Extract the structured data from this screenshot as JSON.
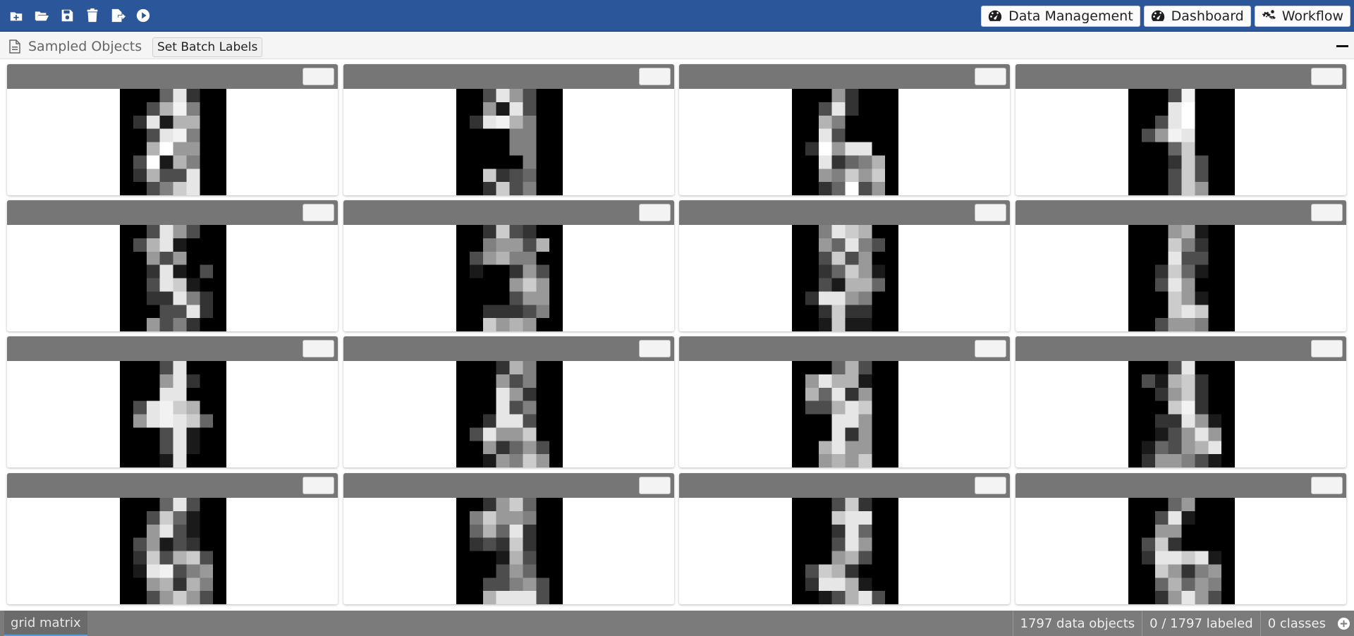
{
  "toolbar": {
    "icons": [
      "new-icon",
      "open-folder-icon",
      "save-icon",
      "delete-icon",
      "export-icon",
      "run-icon"
    ],
    "nav": {
      "data_management": "Data Management",
      "dashboard": "Dashboard",
      "workflow": "Workflow"
    }
  },
  "panel": {
    "title": "Sampled Objects",
    "batch_button": "Set Batch Labels"
  },
  "grid": {
    "rows": 4,
    "columns": 4,
    "cards": [
      {
        "label": "",
        "pixels": [
          0,
          0,
          0,
          0.4,
          0.9,
          0.2,
          0,
          0,
          0,
          0,
          0.3,
          0.7,
          0.95,
          0.5,
          0,
          0,
          0,
          0.2,
          0.9,
          0.1,
          0.7,
          0.7,
          0,
          0,
          0,
          0,
          0.3,
          0.9,
          0.95,
          0.5,
          0,
          0,
          0,
          0,
          0.7,
          1,
          0.6,
          0.6,
          0,
          0,
          0,
          0.3,
          1,
          0.1,
          0.7,
          0.5,
          0,
          0,
          0,
          0.2,
          0.7,
          0.3,
          0.3,
          0.9,
          0,
          0,
          0,
          0,
          0.3,
          0.5,
          0.8,
          0.9,
          0,
          0
        ]
      },
      {
        "label": "",
        "pixels": [
          0,
          0,
          0.3,
          0.9,
          0.6,
          0.3,
          0,
          0,
          0,
          0,
          0.6,
          0.1,
          0.9,
          0.3,
          0,
          0,
          0,
          0.2,
          0.9,
          0.95,
          0.7,
          0.5,
          0,
          0,
          0,
          0,
          0,
          0,
          0.5,
          0.5,
          0,
          0,
          0,
          0,
          0,
          0,
          0.5,
          0.5,
          0,
          0,
          0,
          0,
          0,
          0,
          0,
          0.5,
          0,
          0,
          0,
          0,
          0.8,
          0.2,
          0.3,
          0.4,
          0,
          0,
          0,
          0,
          0.2,
          0.8,
          0.3,
          0.5,
          0,
          0
        ]
      },
      {
        "label": "",
        "pixels": [
          0,
          0,
          0,
          0.6,
          0.2,
          0,
          0,
          0,
          0,
          0,
          0.3,
          0.9,
          0.2,
          0,
          0,
          0,
          0,
          0,
          0.7,
          0.5,
          0,
          0,
          0,
          0,
          0,
          0,
          0.9,
          0.3,
          0,
          0,
          0,
          0,
          0,
          0.2,
          1,
          0.6,
          0.9,
          0.9,
          0,
          0,
          0,
          0,
          0.9,
          0.2,
          0.4,
          0.5,
          0.7,
          0,
          0,
          0,
          0.6,
          0.5,
          0.8,
          0.6,
          0.8,
          0,
          0,
          0,
          0.2,
          0.4,
          1,
          0.3,
          0.6,
          0
        ]
      },
      {
        "label": "",
        "pixels": [
          0,
          0,
          0,
          0.3,
          0.95,
          0,
          0,
          0,
          0,
          0,
          0,
          0.9,
          1,
          0,
          0,
          0,
          0,
          0,
          0.3,
          0.9,
          1,
          0,
          0,
          0,
          0,
          0.3,
          0.6,
          0.95,
          0.9,
          0,
          0,
          0,
          0,
          0,
          0,
          0.4,
          0.8,
          0,
          0,
          0,
          0,
          0,
          0,
          0.2,
          0.8,
          0.3,
          0,
          0,
          0,
          0,
          0,
          0.3,
          0.8,
          0.3,
          0,
          0,
          0,
          0,
          0,
          0.3,
          0.8,
          0.6,
          0,
          0
        ]
      },
      {
        "label": "",
        "pixels": [
          0,
          0,
          0.3,
          0.9,
          0.6,
          0.3,
          0,
          0,
          0,
          0.3,
          0.7,
          0.9,
          0.1,
          0,
          0,
          0,
          0,
          0,
          0.6,
          0.3,
          0.6,
          0,
          0,
          0,
          0,
          0,
          0.2,
          0.9,
          0.1,
          0,
          0.3,
          0,
          0,
          0,
          0.3,
          0.9,
          0.8,
          0.1,
          0,
          0,
          0,
          0,
          0.2,
          0.2,
          0.9,
          0.5,
          0.2,
          0,
          0,
          0,
          0,
          0.3,
          0.3,
          0.9,
          0.2,
          0,
          0,
          0,
          0.6,
          0.3,
          0.5,
          0.2,
          0,
          0
        ]
      },
      {
        "label": "",
        "pixels": [
          0,
          0,
          0.2,
          0.8,
          0.3,
          0.2,
          0,
          0,
          0,
          0,
          0.5,
          0.6,
          0.6,
          0.3,
          0.7,
          0,
          0,
          0.3,
          0.6,
          0.7,
          0.5,
          0.5,
          0,
          0,
          0,
          0.1,
          0,
          0,
          0.2,
          0.6,
          0.3,
          0,
          0,
          0,
          0,
          0,
          0.6,
          0.8,
          0.6,
          0,
          0,
          0,
          0,
          0,
          0.3,
          0.6,
          0.6,
          0,
          0,
          0,
          0.2,
          0.2,
          0.2,
          0.3,
          0.5,
          0,
          0,
          0,
          0.8,
          0.6,
          0.7,
          0.6,
          0,
          0
        ]
      },
      {
        "label": "",
        "pixels": [
          0,
          0,
          0.5,
          0.9,
          0.8,
          0.7,
          0,
          0,
          0,
          0,
          0.6,
          0.4,
          0.9,
          0.5,
          0.3,
          0,
          0,
          0,
          0.3,
          0.8,
          0.3,
          0.6,
          0,
          0,
          0,
          0,
          0.2,
          0.4,
          0.8,
          0.6,
          0.1,
          0,
          0,
          0,
          0.3,
          0.1,
          0.7,
          0.7,
          0.4,
          0,
          0,
          0.2,
          0.9,
          0.9,
          0.6,
          0.5,
          0,
          0,
          0,
          0,
          0.2,
          0.8,
          0.2,
          0.2,
          0,
          0,
          0,
          0,
          0.1,
          0.8,
          0.1,
          0.1,
          0,
          0
        ]
      },
      {
        "label": "",
        "pixels": [
          0,
          0,
          0,
          0.6,
          0.7,
          0.1,
          0,
          0,
          0,
          0,
          0,
          0.8,
          0.5,
          0.2,
          0,
          0,
          0,
          0,
          0,
          0.9,
          0.3,
          0.3,
          0,
          0,
          0,
          0,
          0.2,
          0.8,
          0.4,
          0.1,
          0,
          0,
          0,
          0,
          0.3,
          0.9,
          0.6,
          0,
          0,
          0,
          0,
          0,
          0,
          0.8,
          0.6,
          0.1,
          0,
          0,
          0,
          0,
          0,
          0.8,
          0.9,
          0.8,
          0,
          0,
          0,
          0,
          0.3,
          0.6,
          0.6,
          0.5,
          0,
          0
        ]
      },
      {
        "label": "",
        "pixels": [
          0,
          0,
          0,
          0.3,
          0.9,
          0,
          0,
          0,
          0,
          0,
          0,
          0.6,
          0.9,
          0.2,
          0,
          0,
          0,
          0,
          0,
          0.9,
          0.9,
          0,
          0,
          0,
          0,
          0.3,
          0.9,
          0.95,
          0.8,
          0.7,
          0,
          0,
          0,
          0.6,
          0.9,
          0.95,
          0.9,
          0.8,
          0.4,
          0,
          0,
          0,
          0,
          0.3,
          0.9,
          0.1,
          0,
          0,
          0,
          0,
          0,
          0.3,
          0.9,
          0.1,
          0,
          0,
          0,
          0,
          0,
          0.1,
          0.9,
          0,
          0,
          0
        ]
      },
      {
        "label": "",
        "pixels": [
          0,
          0,
          0,
          0.2,
          0.7,
          0.5,
          0,
          0,
          0,
          0,
          0,
          0.6,
          0.3,
          0.5,
          0,
          0,
          0,
          0,
          0,
          0.9,
          0.6,
          0.2,
          0,
          0,
          0,
          0,
          0,
          0.9,
          0.3,
          0.5,
          0,
          0,
          0,
          0,
          0.2,
          0.9,
          0.9,
          0.3,
          0,
          0,
          0,
          0.3,
          0.9,
          0.6,
          0.6,
          0.8,
          0,
          0,
          0,
          0,
          0.6,
          0.2,
          0.4,
          0.6,
          0.3,
          0,
          0,
          0,
          0.1,
          0.6,
          0.5,
          0.8,
          0.6,
          0
        ]
      },
      {
        "label": "",
        "pixels": [
          0,
          0,
          0,
          0.4,
          0.7,
          0.3,
          0,
          0,
          0,
          0.6,
          0.9,
          0.7,
          0.7,
          0.1,
          0,
          0,
          0,
          0.7,
          0.4,
          0.9,
          0.2,
          0.6,
          0,
          0,
          0,
          0.3,
          0.3,
          0.7,
          0.9,
          0.8,
          0,
          0,
          0,
          0,
          0,
          0.9,
          0.9,
          0.6,
          0,
          0,
          0,
          0,
          0,
          0.9,
          0.2,
          0.6,
          0,
          0,
          0,
          0,
          0.7,
          0.9,
          0.6,
          0.6,
          0,
          0,
          0,
          0,
          0.6,
          0.7,
          0.6,
          0.8,
          0,
          0
        ]
      },
      {
        "label": "",
        "pixels": [
          0,
          0,
          0,
          0.3,
          0.9,
          0,
          0,
          0,
          0,
          0.3,
          0.1,
          0.7,
          0.8,
          0.2,
          0,
          0,
          0,
          0,
          0.2,
          0.6,
          0.8,
          0.2,
          0,
          0,
          0,
          0,
          0,
          0.8,
          0.95,
          0.2,
          0,
          0,
          0,
          0,
          0.2,
          0.2,
          0.9,
          0.6,
          0.1,
          0,
          0,
          0,
          0.1,
          0.3,
          0.6,
          0.9,
          0.6,
          0,
          0,
          0.1,
          0.4,
          0.3,
          0.6,
          0.7,
          0.9,
          0,
          0,
          0.2,
          0.6,
          0.6,
          0.5,
          0.3,
          0.1,
          0
        ]
      },
      {
        "label": "",
        "pixels": [
          0,
          0,
          0,
          0.4,
          0.9,
          0.3,
          0,
          0,
          0,
          0,
          0.3,
          0.8,
          0.4,
          0.1,
          0,
          0,
          0,
          0,
          0.6,
          0.9,
          0.3,
          0.1,
          0,
          0,
          0,
          0.3,
          0.6,
          0.1,
          0.3,
          0.2,
          0,
          0,
          0,
          0.2,
          0.8,
          0.3,
          0.7,
          0.8,
          0.3,
          0,
          0,
          0.1,
          0.9,
          0.95,
          0.3,
          0.5,
          0.6,
          0,
          0,
          0,
          0.6,
          0.7,
          0.2,
          0.7,
          0.5,
          0,
          0,
          0,
          0.3,
          0.6,
          0.8,
          0.6,
          0.3,
          0
        ]
      },
      {
        "label": "",
        "pixels": [
          0,
          0,
          0.2,
          0.6,
          0.8,
          0.4,
          0,
          0,
          0,
          0.5,
          0.8,
          0.6,
          0.6,
          0.5,
          0,
          0,
          0,
          0.4,
          0.7,
          0.4,
          0.9,
          0.2,
          0,
          0,
          0,
          0.2,
          0.3,
          0.2,
          0.8,
          0.2,
          0,
          0,
          0,
          0,
          0,
          0.1,
          0.7,
          0.3,
          0,
          0,
          0,
          0,
          0,
          0.3,
          0.6,
          0.4,
          0,
          0,
          0,
          0,
          0.3,
          0.3,
          0.5,
          0.6,
          0.3,
          0,
          0,
          0,
          0.7,
          0.9,
          0.9,
          0.9,
          0.3,
          0
        ]
      },
      {
        "label": "",
        "pixels": [
          0,
          0,
          0,
          0.3,
          0.8,
          0.2,
          0,
          0,
          0,
          0,
          0,
          0.8,
          0.9,
          0.9,
          0,
          0,
          0,
          0,
          0,
          0.2,
          0.9,
          0.4,
          0,
          0,
          0,
          0,
          0,
          0.3,
          0.9,
          0.6,
          0,
          0,
          0,
          0,
          0,
          0.6,
          0.7,
          0.3,
          0,
          0,
          0,
          0.3,
          0.8,
          0.7,
          0.2,
          0,
          0,
          0,
          0,
          0.2,
          0.9,
          0.9,
          0.7,
          0.1,
          0,
          0,
          0,
          0,
          0.1,
          0.3,
          0.7,
          0.9,
          0.3,
          0
        ]
      },
      {
        "label": "",
        "pixels": [
          0,
          0,
          0,
          0.4,
          0.6,
          0,
          0,
          0,
          0,
          0,
          0.3,
          0.9,
          0.1,
          0,
          0,
          0,
          0,
          0,
          0.6,
          0.6,
          0,
          0,
          0,
          0,
          0,
          0.3,
          0.8,
          0.2,
          0,
          0,
          0,
          0,
          0,
          0.2,
          0.9,
          0.9,
          0.8,
          0.9,
          0.1,
          0,
          0,
          0,
          0.8,
          0.6,
          0.2,
          0.5,
          0.6,
          0,
          0,
          0,
          0.4,
          0.7,
          0.4,
          0.6,
          0.5,
          0,
          0,
          0,
          0.2,
          0.6,
          0.9,
          0.6,
          0.3,
          0
        ]
      }
    ]
  },
  "footer": {
    "tab": "grid matrix",
    "objects": "1797 data objects",
    "labeled": "0 / 1797 labeled",
    "classes": "0 classes"
  },
  "colors": {
    "topbar": "#2b5699",
    "card_bar": "#767676",
    "footer": "#7b7b7b"
  }
}
